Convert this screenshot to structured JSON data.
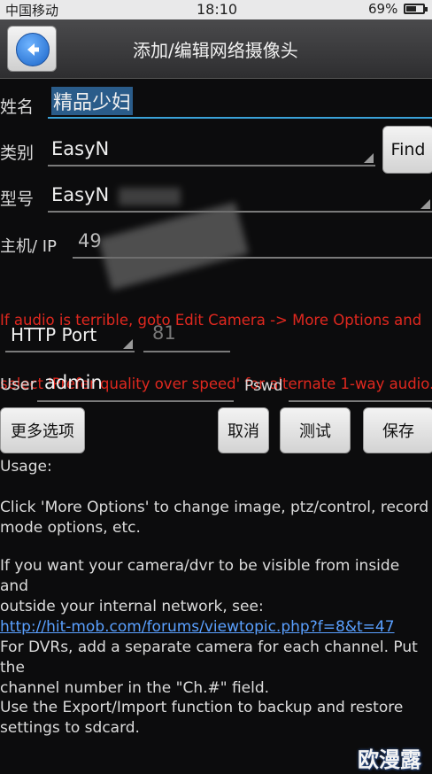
{
  "status": {
    "carrier": "中国移动",
    "time": "18:10",
    "battery": "69%",
    "battery_level": 0.69
  },
  "header": {
    "title": "添加/编辑网络摄像头"
  },
  "form": {
    "name_label": "姓名",
    "name_value": "精品少妇",
    "category_label": "类别",
    "category_value": "EasyN",
    "find_label": "Find",
    "model_label": "型号",
    "model_value": "EasyN",
    "host_label": "主机/ IP",
    "host_value": "49",
    "port_label": "HTTP Port",
    "port_value": "81",
    "user_label": "User",
    "user_value": "admin",
    "pswd_label": "Pswd",
    "pswd_value": ""
  },
  "warning": {
    "line1": "If audio is terrible, goto Edit Camera -> More Options and",
    "line2": "select 'Prefer quality over speed' for alternate 1-way audio."
  },
  "buttons": {
    "more_options": "更多选项",
    "cancel": "取消",
    "test": "测试",
    "save": "保存"
  },
  "usage": {
    "heading": "Usage:",
    "p1_l1": "Click 'More Options' to change image, ptz/control, record",
    "p1_l2": "mode options, etc.",
    "p2_l1": "If you want your camera/dvr to be visible from inside and",
    "p2_l2": "outside your internal network, see:",
    "p2_link": "http://hit-mob.com/forums/viewtopic.php?f=8&t=47",
    "p3_l1": "For DVRs, add a separate camera for each channel. Put the",
    "p3_l2": "channel number in the \"Ch.#\" field.",
    "p4_l1": "Use the Export/Import function to backup and restore",
    "p4_l2": "settings to sdcard."
  },
  "watermark": "欧漫露",
  "colors": {
    "accent": "#3aa2d8",
    "warning": "#e0281f",
    "link": "#5aa0ff"
  }
}
